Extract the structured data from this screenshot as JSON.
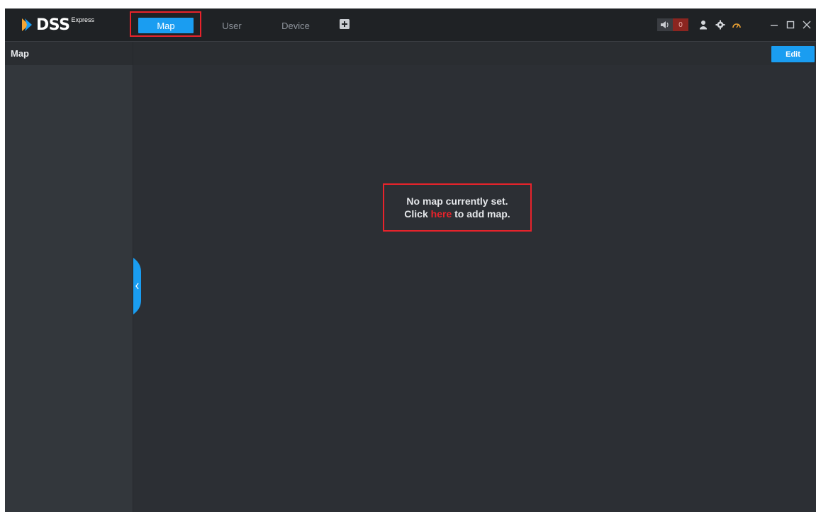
{
  "window": {
    "app_name": "DSS",
    "app_edition": "Express"
  },
  "nav": {
    "tabs": [
      {
        "label": "Map",
        "active": true
      },
      {
        "label": "User",
        "active": false
      },
      {
        "label": "Device",
        "active": false
      }
    ],
    "add_tab_icon": "plus-square-icon"
  },
  "toolbar": {
    "alarm_count": "0",
    "icons": [
      "speaker-icon",
      "user-icon",
      "gear-icon",
      "gauge-icon",
      "minimize-icon",
      "maximize-icon",
      "close-icon"
    ]
  },
  "sidebar": {
    "title": "Map"
  },
  "main": {
    "edit_label": "Edit",
    "empty_line1": "No map currently set.",
    "empty_prefix": "Click",
    "empty_link": "here",
    "empty_suffix": "to add map."
  },
  "colors": {
    "accent": "#1a9df1",
    "highlight": "#e8232b",
    "topbar": "#1f2225",
    "panel": "#2c2f34"
  }
}
